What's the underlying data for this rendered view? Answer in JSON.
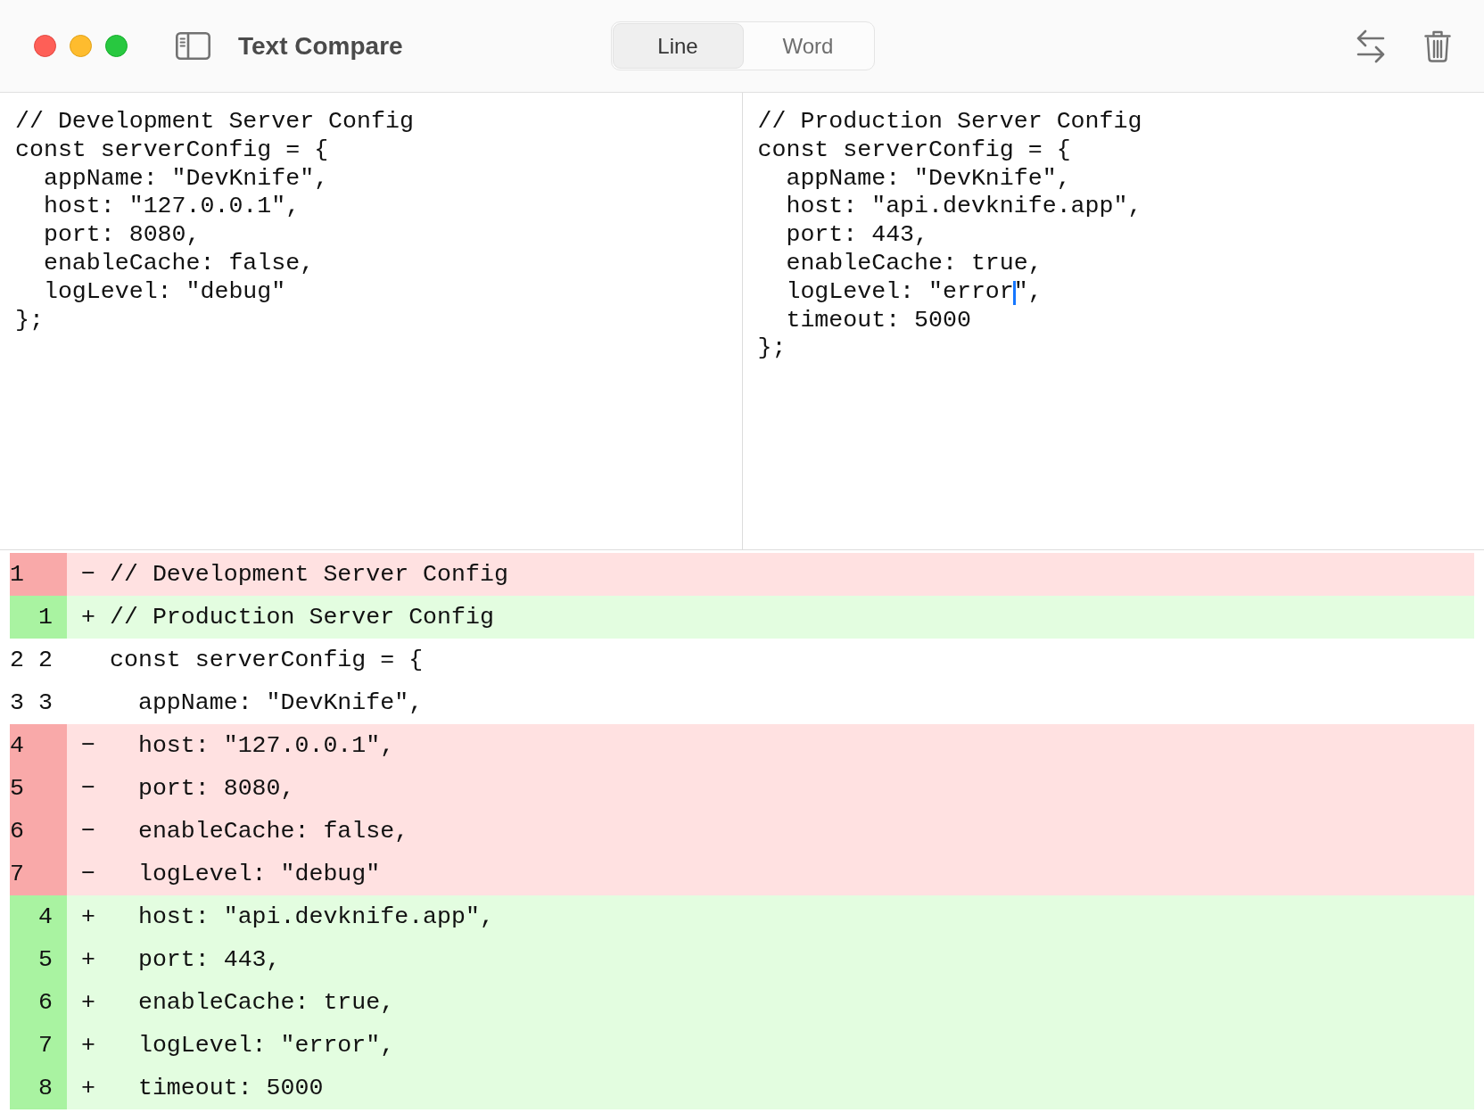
{
  "window": {
    "title": "Text Compare"
  },
  "mode_tabs": [
    {
      "label": "Line",
      "selected": true
    },
    {
      "label": "Word",
      "selected": false
    }
  ],
  "left_editor": {
    "lines": [
      {
        "text": "// Development Server Config",
        "caret": false
      },
      {
        "text": "const serverConfig = {",
        "caret": false
      },
      {
        "text": "  appName: \"DevKnife\",",
        "caret": false
      },
      {
        "text": "  host: \"127.0.0.1\",",
        "caret": false
      },
      {
        "text": "  port: 8080,",
        "caret": false
      },
      {
        "text": "  enableCache: false,",
        "caret": false
      },
      {
        "text": "  logLevel: \"debug\"",
        "caret": false
      },
      {
        "text": "};",
        "caret": false
      }
    ]
  },
  "right_editor": {
    "lines": [
      {
        "text": "// Production Server Config",
        "caret": false
      },
      {
        "text": "const serverConfig = {",
        "caret": false
      },
      {
        "text": "  appName: \"DevKnife\",",
        "caret": false
      },
      {
        "text": "  host: \"api.devknife.app\",",
        "caret": false
      },
      {
        "text": "  port: 443,",
        "caret": false
      },
      {
        "text": "  enableCache: true,",
        "caret": false
      },
      {
        "text": "  logLevel: \"error",
        "caret": true,
        "after_caret": "\","
      },
      {
        "text": "  timeout: 5000",
        "caret": false
      },
      {
        "text": "};",
        "caret": false
      }
    ]
  },
  "diff": {
    "rows": [
      {
        "kind": "removed",
        "old": "1",
        "marker": "−",
        "text": "// Development Server Config"
      },
      {
        "kind": "added",
        "new": "1",
        "marker": "+",
        "text": "// Production Server Config"
      },
      {
        "kind": "unchanged",
        "old": "2",
        "new": "2",
        "text": "const serverConfig = {"
      },
      {
        "kind": "unchanged",
        "old": "3",
        "new": "3",
        "text": "  appName: \"DevKnife\","
      },
      {
        "kind": "removed",
        "old": "4",
        "marker": "−",
        "text": "  host: \"127.0.0.1\","
      },
      {
        "kind": "removed",
        "old": "5",
        "marker": "−",
        "text": "  port: 8080,"
      },
      {
        "kind": "removed",
        "old": "6",
        "marker": "−",
        "text": "  enableCache: false,"
      },
      {
        "kind": "removed",
        "old": "7",
        "marker": "−",
        "text": "  logLevel: \"debug\""
      },
      {
        "kind": "added",
        "new": "4",
        "marker": "+",
        "text": "  host: \"api.devknife.app\","
      },
      {
        "kind": "added",
        "new": "5",
        "marker": "+",
        "text": "  port: 443,"
      },
      {
        "kind": "added",
        "new": "6",
        "marker": "+",
        "text": "  enableCache: true,"
      },
      {
        "kind": "added",
        "new": "7",
        "marker": "+",
        "text": "  logLevel: \"error\","
      },
      {
        "kind": "added",
        "new": "8",
        "marker": "+",
        "text": "  timeout: 5000"
      }
    ]
  }
}
